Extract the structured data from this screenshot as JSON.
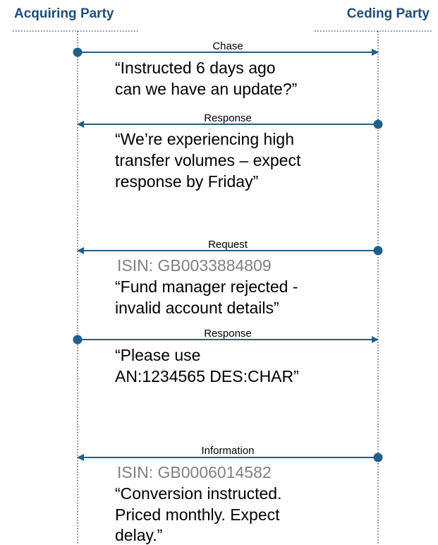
{
  "parties": {
    "left": "Acquiring Party",
    "right": "Ceding Party"
  },
  "colors": {
    "party_label": "#1f4e79",
    "arrow": "#1f5f8b",
    "lifeline": "#000000",
    "isin": "#808080",
    "text": "#000000"
  },
  "messages": [
    {
      "label": "Chase",
      "direction": "right",
      "isin": "",
      "lines": [
        "“Instructed 6 days ago",
        "can we have an update?”"
      ]
    },
    {
      "label": "Response",
      "direction": "left",
      "isin": "",
      "lines": [
        "“We’re experiencing high",
        "transfer volumes – expect",
        "response by Friday”"
      ]
    },
    {
      "label": "Request",
      "direction": "left",
      "isin": "ISIN:  GB0033884809",
      "lines": [
        "“Fund manager rejected -",
        "invalid account details”"
      ]
    },
    {
      "label": "Response",
      "direction": "right",
      "isin": "",
      "lines": [
        "“Please use",
        "AN:1234565 DES:CHAR”"
      ]
    },
    {
      "label": "Information",
      "direction": "left",
      "isin": "ISIN:  GB0006014582",
      "lines": [
        "“Conversion instructed.",
        "Priced monthly. Expect",
        "delay.”"
      ]
    }
  ]
}
